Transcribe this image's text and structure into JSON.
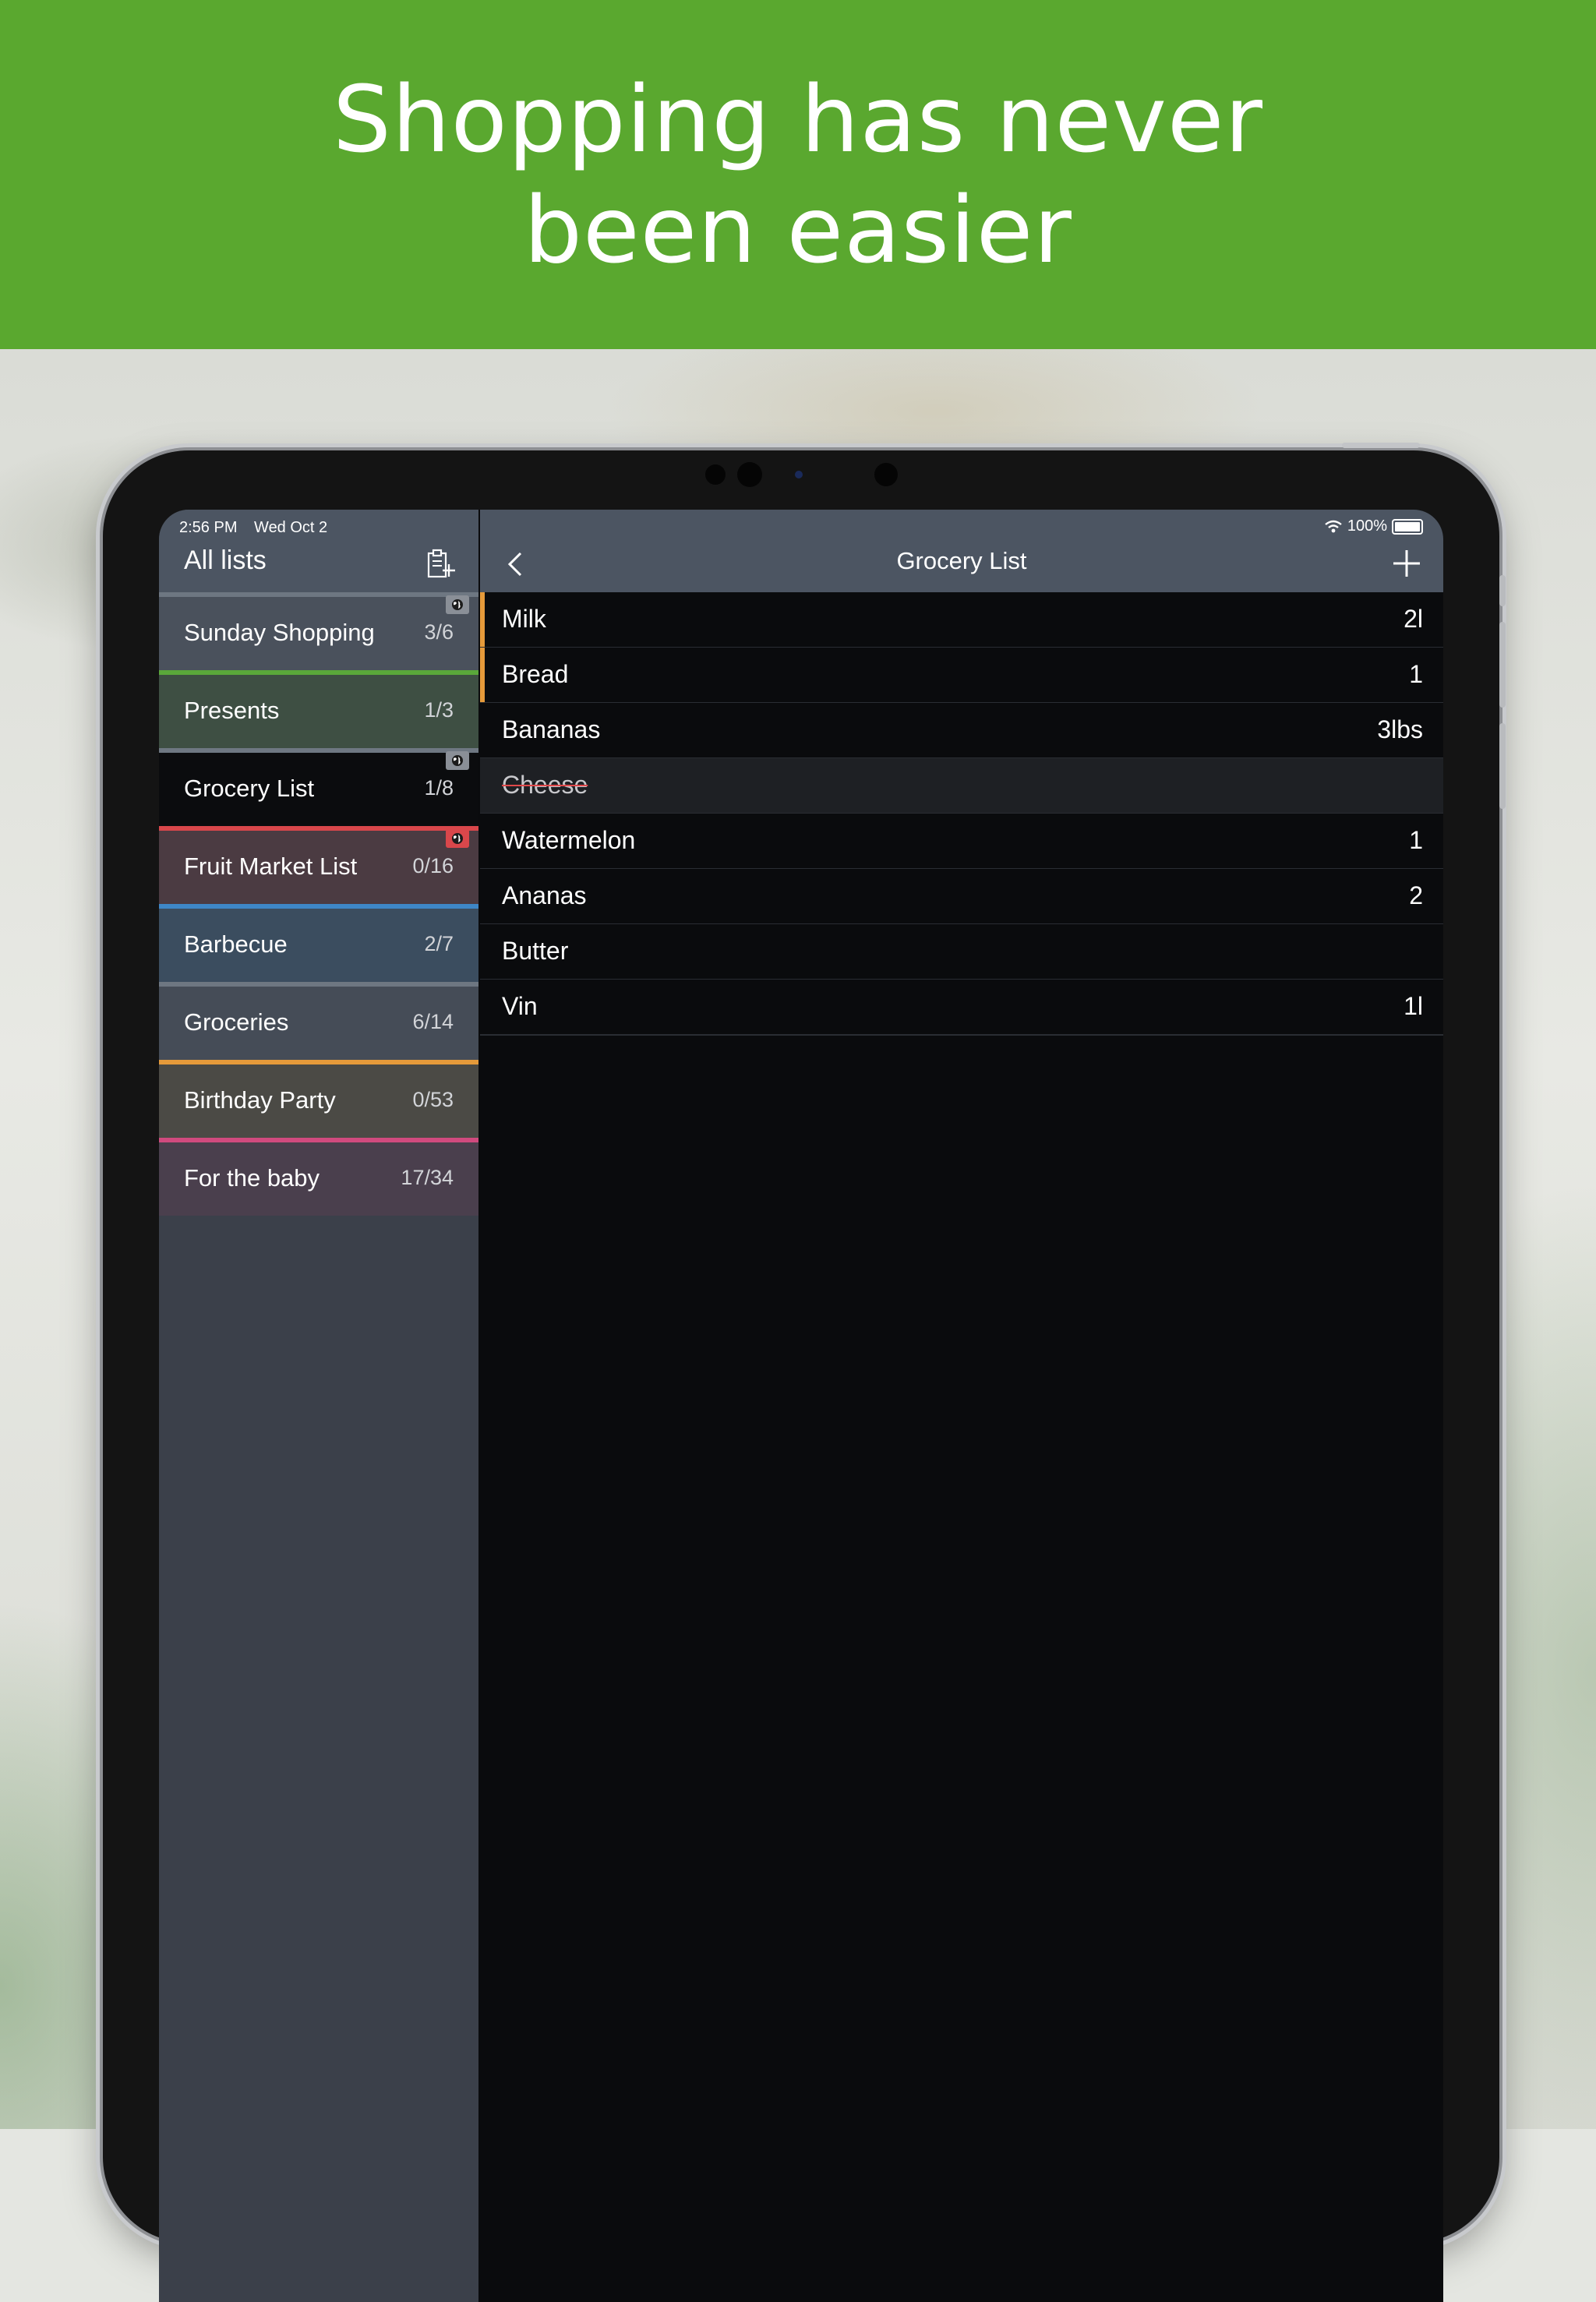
{
  "banner": {
    "line1": "Shopping has never",
    "line2": "been easier"
  },
  "status_bar": {
    "time": "2:56 PM",
    "date": "Wed Oct 2",
    "battery": "100%"
  },
  "sidebar": {
    "title": "All lists",
    "new_list_icon": "clipboard-add-icon",
    "lists": [
      {
        "name": "Sunday Shopping",
        "count": "3/6",
        "color": "#6e7782",
        "bg": "#4a515c",
        "shared": true,
        "badge_color": "#8a8f97"
      },
      {
        "name": "Presents",
        "count": "1/3",
        "color": "#5aa83a",
        "bg": "#3e4f43",
        "shared": false
      },
      {
        "name": "Grocery List",
        "count": "1/8",
        "color": "#6e7782",
        "bg": "#0b0c0e",
        "shared": true,
        "badge_color": "#8a8f97",
        "selected": true
      },
      {
        "name": "Fruit Market List",
        "count": "0/16",
        "color": "#d9474b",
        "bg": "#4b3b42",
        "shared": true,
        "badge_color": "#d9474b"
      },
      {
        "name": "Barbecue",
        "count": "2/7",
        "color": "#3e86c6",
        "bg": "#3b4d5f",
        "shared": false
      },
      {
        "name": "Groceries",
        "count": "6/14",
        "color": "#6e7782",
        "bg": "#454c57",
        "shared": false
      },
      {
        "name": "Birthday Party",
        "count": "0/53",
        "color": "#e59a3a",
        "bg": "#4b4a45",
        "shared": false
      },
      {
        "name": "For the baby",
        "count": "17/34",
        "color": "#d04a7e",
        "bg": "#4a3f4d",
        "shared": false
      }
    ]
  },
  "detail": {
    "title": "Grocery List",
    "back_icon": "chevron-left-icon",
    "add_icon": "plus-icon",
    "accent_color": "#e59a3a",
    "items": [
      {
        "name": "Milk",
        "qty": "2l",
        "accent": true,
        "checked": false
      },
      {
        "name": "Bread",
        "qty": "1",
        "accent": true,
        "checked": false
      },
      {
        "name": "Bananas",
        "qty": "3lbs",
        "accent": false,
        "checked": false
      },
      {
        "name": "Cheese",
        "qty": "",
        "accent": false,
        "checked": true
      },
      {
        "name": "Watermelon",
        "qty": "1",
        "accent": false,
        "checked": false
      },
      {
        "name": "Ananas",
        "qty": "2",
        "accent": false,
        "checked": false
      },
      {
        "name": "Butter",
        "qty": "",
        "accent": false,
        "checked": false
      },
      {
        "name": "Vin",
        "qty": "1l",
        "accent": false,
        "checked": false
      }
    ]
  }
}
